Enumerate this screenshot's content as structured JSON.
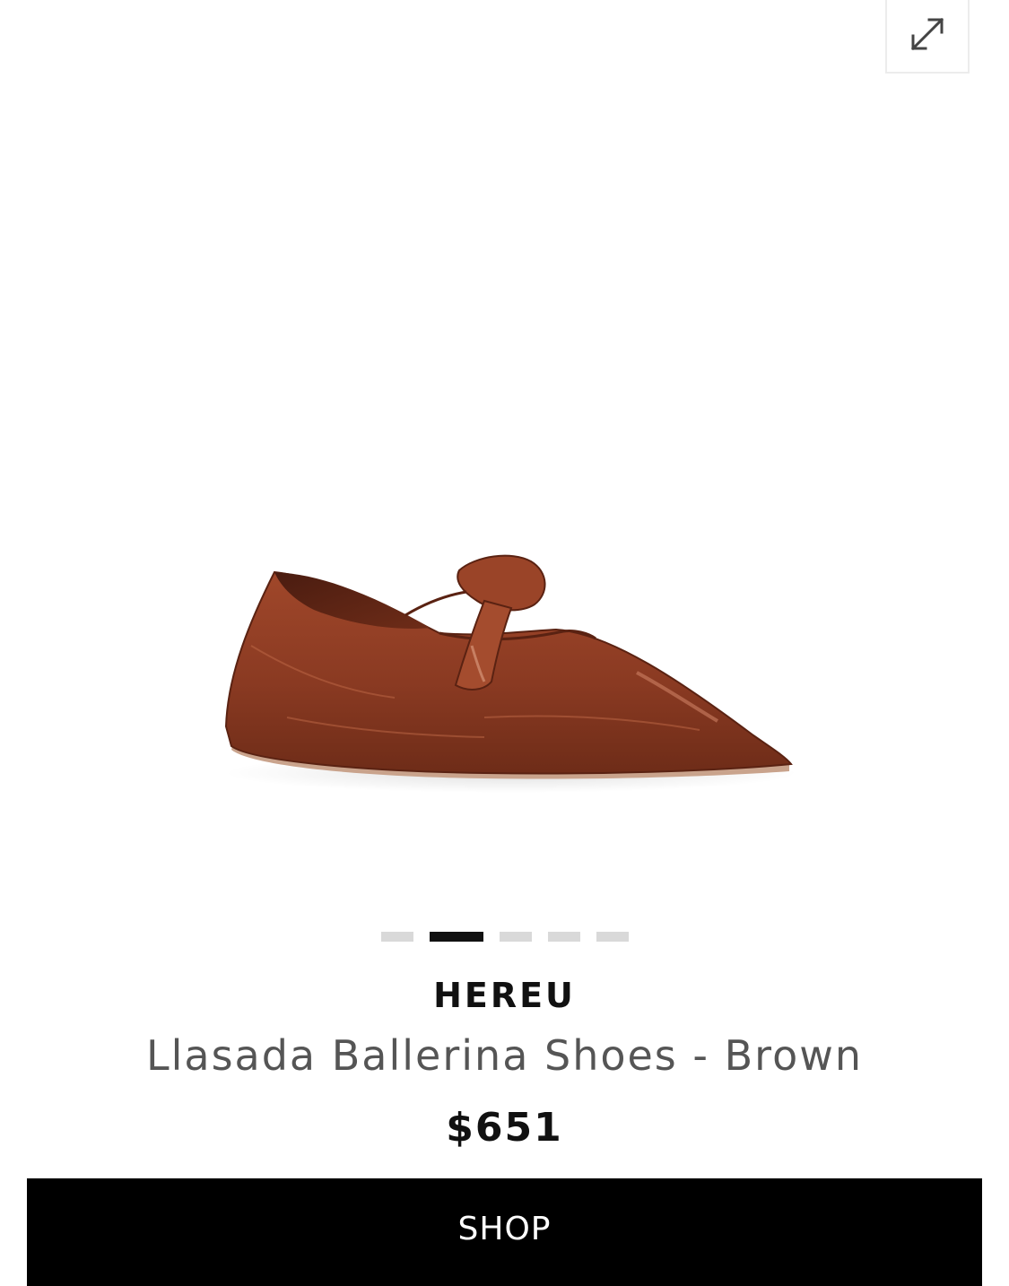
{
  "toolbar": {
    "expand_icon": "expand-arrows-icon"
  },
  "gallery": {
    "image_subject": "brown patent leather ballerina shoe",
    "slide_count": 5,
    "active_slide": 2
  },
  "product": {
    "brand": "HEREU",
    "name": "Llasada Ballerina Shoes - Brown",
    "price": "$651"
  },
  "actions": {
    "shop_label": "SHOP"
  },
  "colors": {
    "shoe": "#8a3a22",
    "button_bg": "#000000",
    "dot_active": "#111111",
    "dot_inactive": "#d9d9d9"
  }
}
